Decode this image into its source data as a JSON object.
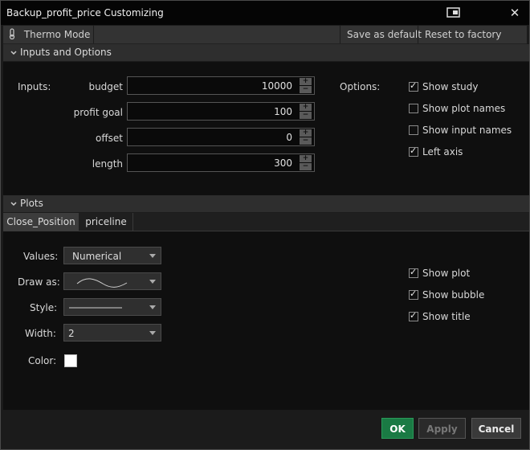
{
  "window": {
    "title": "Backup_profit_price Customizing"
  },
  "toolbar": {
    "thermo_label": "Thermo Mode",
    "save_default_label": "Save as default",
    "reset_label": "Reset to factory default"
  },
  "inputs_section": {
    "header": "Inputs and Options",
    "inputs_label": "Inputs:",
    "options_label": "Options:",
    "fields": [
      {
        "label": "budget",
        "value": "10000"
      },
      {
        "label": "profit goal",
        "value": "100"
      },
      {
        "label": "offset",
        "value": "0"
      },
      {
        "label": "length",
        "value": "300"
      }
    ],
    "options": [
      {
        "label": "Show study",
        "checked": true
      },
      {
        "label": "Show plot names",
        "checked": false
      },
      {
        "label": "Show input names",
        "checked": false
      },
      {
        "label": "Left axis",
        "checked": true
      }
    ]
  },
  "plots_section": {
    "header": "Plots",
    "tabs": [
      "Close_Position",
      "priceline"
    ],
    "active_tab": "Close_Position",
    "values_label": "Values:",
    "values_value": "Numerical",
    "draw_as_label": "Draw as:",
    "style_label": "Style:",
    "width_label": "Width:",
    "width_value": "2",
    "color_label": "Color:",
    "color_value": "#ffffff",
    "plot_options": [
      {
        "label": "Show plot",
        "checked": true
      },
      {
        "label": "Show bubble",
        "checked": true
      },
      {
        "label": "Show title",
        "checked": true
      }
    ]
  },
  "footer": {
    "ok_label": "OK",
    "apply_label": "Apply",
    "cancel_label": "Cancel"
  },
  "colors": {
    "ok_green": "#1a7a44",
    "title_bar": "#050505",
    "panel": "#0f0f0f"
  }
}
